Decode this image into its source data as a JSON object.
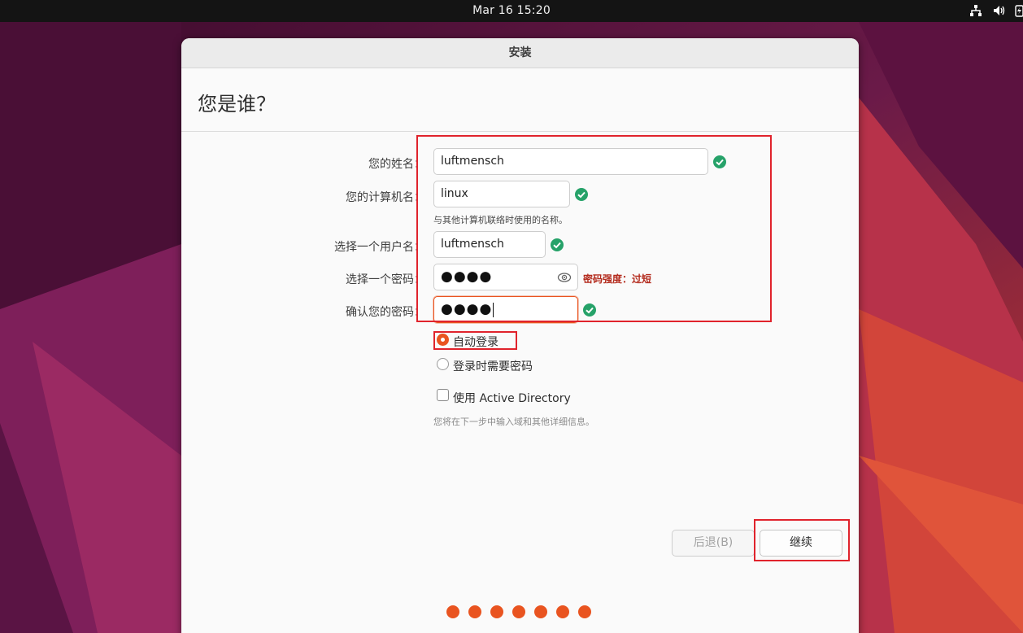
{
  "topbar": {
    "clock": "Mar 16  15:20",
    "tray_icons": [
      "network-icon",
      "volume-icon",
      "battery-icon"
    ]
  },
  "window": {
    "title": "安装",
    "heading": "您是谁？"
  },
  "form": {
    "name_label": "您的姓名：",
    "name_value": "luftmensch",
    "computer_label": "您的计算机名：",
    "computer_value": "linux",
    "computer_hint": "与其他计算机联络时使用的名称。",
    "username_label": "选择一个用户名：",
    "username_value": "luftmensch",
    "password_label": "选择一个密码：",
    "password_value": "●●●●",
    "password_strength": "密码强度：过短",
    "confirm_label": "确认您的密码：",
    "confirm_value": "●●●●"
  },
  "login": {
    "auto_login": "自动登录",
    "require_password": "登录时需要密码",
    "selected": "auto_login"
  },
  "ad": {
    "label": "使用 Active Directory",
    "checked": false,
    "hint": "您将在下一步中输入域和其他详细信息。"
  },
  "buttons": {
    "back": "后退(B)",
    "continue": "继续"
  },
  "progress": {
    "steps": 7,
    "current": 7
  },
  "colors": {
    "accent": "#e95420",
    "success": "#26a269",
    "warning_text": "#b32a1c",
    "annotation": "#e0232c"
  }
}
